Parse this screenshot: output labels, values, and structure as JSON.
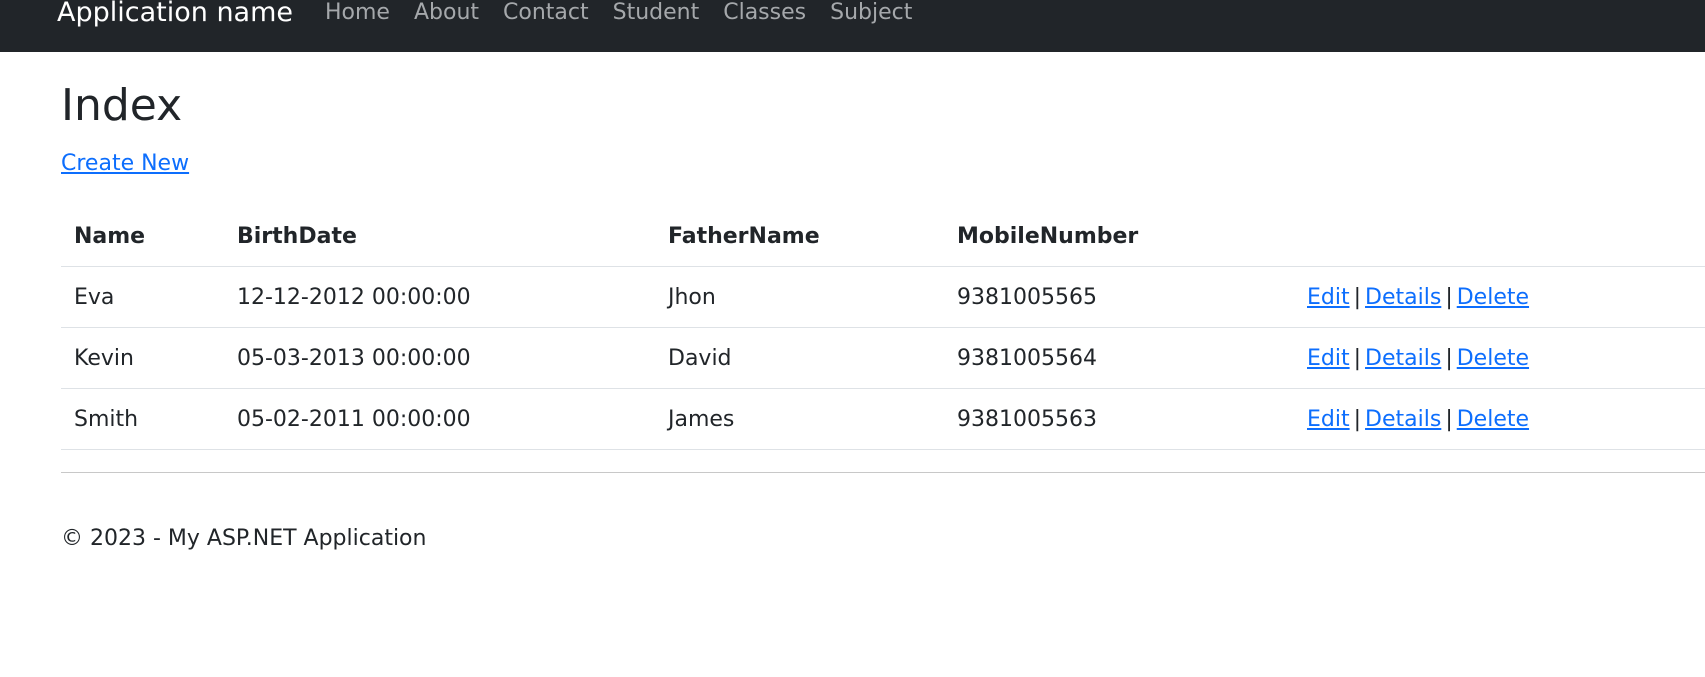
{
  "navbar": {
    "brand": "Application name",
    "links": [
      "Home",
      "About",
      "Contact",
      "Student",
      "Classes",
      "Subject"
    ]
  },
  "page": {
    "title": "Index",
    "create_new": "Create New"
  },
  "table": {
    "headers": [
      "Name",
      "BirthDate",
      "FatherName",
      "MobileNumber"
    ],
    "rows": [
      {
        "name": "Eva",
        "birth_date": "12-12-2012 00:00:00",
        "father_name": "Jhon",
        "mobile": "9381005565"
      },
      {
        "name": "Kevin",
        "birth_date": "05-03-2013 00:00:00",
        "father_name": "David",
        "mobile": "9381005564"
      },
      {
        "name": "Smith",
        "birth_date": "05-02-2011 00:00:00",
        "father_name": "James",
        "mobile": "9381005563"
      }
    ],
    "actions": {
      "edit": "Edit",
      "details": "Details",
      "delete": "Delete",
      "separator": "|"
    }
  },
  "footer": {
    "text": "© 2023 - My ASP.NET Application"
  },
  "colors": {
    "navbar_bg": "#212529",
    "link": "#0d6efd",
    "nav_link": "#a5a8ab"
  }
}
